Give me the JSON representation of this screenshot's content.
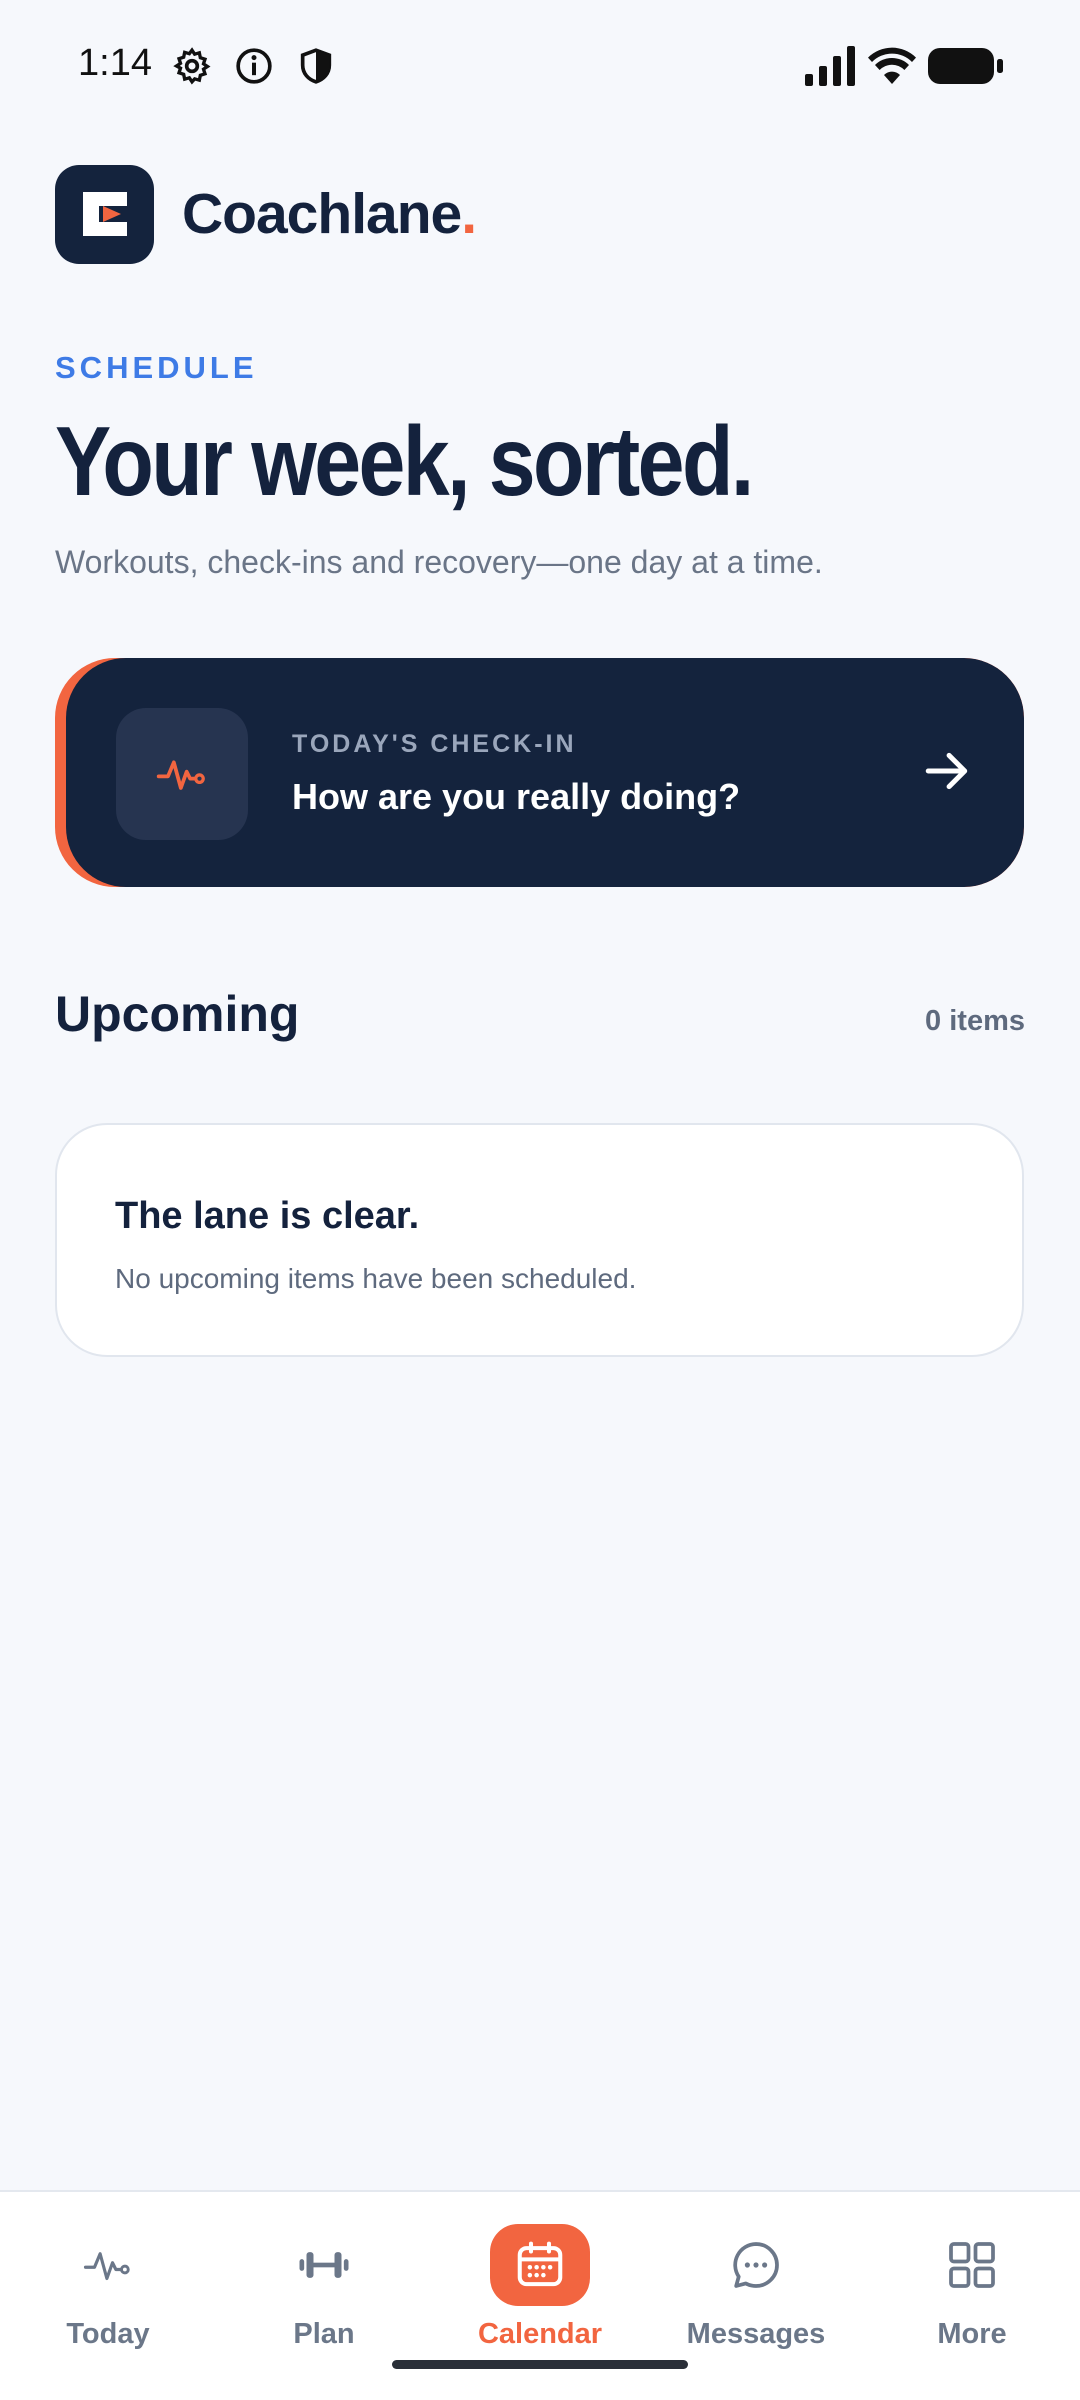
{
  "status_bar": {
    "time": "1:14",
    "icons": [
      "gear-icon",
      "info-icon",
      "shield-icon",
      "signal-icon",
      "wifi-icon",
      "battery-icon"
    ]
  },
  "brand": {
    "name": "Coachlane",
    "dot": ".",
    "accent_color": "#f26540",
    "primary_color": "#14233d"
  },
  "hero": {
    "eyebrow": "SCHEDULE",
    "headline": "Your week, sorted.",
    "subline": "Workouts, check-ins and recovery—one day at a time."
  },
  "checkin": {
    "eyebrow": "TODAY'S CHECK-IN",
    "title": "How are you really doing?",
    "icon": "pulse-icon",
    "action_icon": "arrow-right-icon"
  },
  "upcoming": {
    "title": "Upcoming",
    "count": "0 items",
    "empty_title": "The lane is clear.",
    "empty_sub": "No upcoming items have been scheduled."
  },
  "nav": {
    "items": [
      {
        "label": "Today",
        "icon": "pulse-icon",
        "active": false
      },
      {
        "label": "Plan",
        "icon": "dumbbell-icon",
        "active": false
      },
      {
        "label": "Calendar",
        "icon": "calendar-icon",
        "active": true
      },
      {
        "label": "Messages",
        "icon": "chat-icon",
        "active": false
      },
      {
        "label": "More",
        "icon": "grid-icon",
        "active": false
      }
    ]
  }
}
